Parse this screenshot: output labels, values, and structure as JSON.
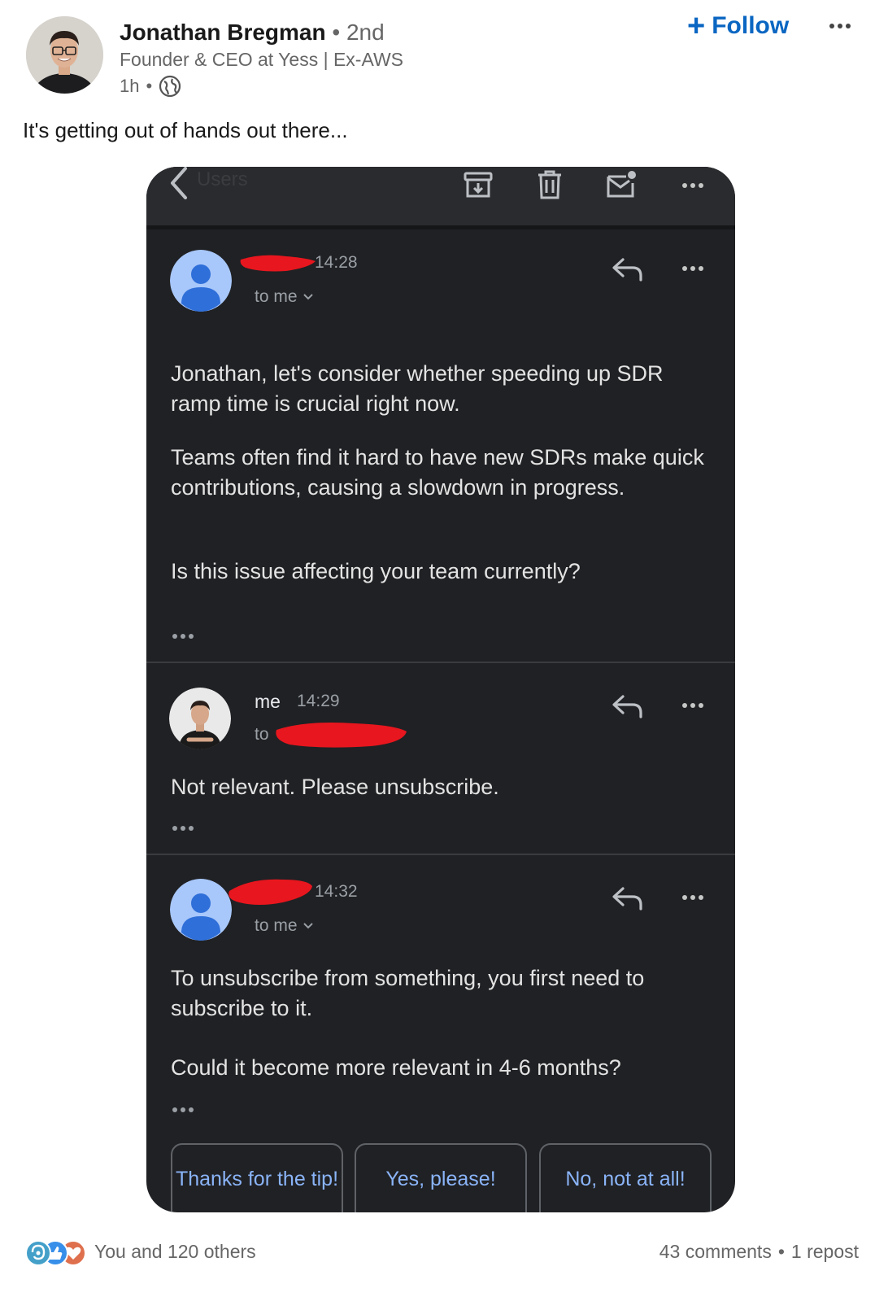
{
  "post": {
    "author_name": "Jonathan Bregman",
    "separator_dot": "•",
    "degree": "2nd",
    "headline": "Founder & CEO at Yess | Ex-AWS",
    "time_ago": "1h",
    "follow_label": "Follow",
    "follow_symbol": "+",
    "text": "It's getting out of hands out there..."
  },
  "email": {
    "back_label": "Users",
    "messages": [
      {
        "time": "14:28",
        "to_label": "to me",
        "body": [
          "Jonathan, let's consider whether speeding up SDR ramp time is crucial right now.",
          "Teams often find it hard to have new SDRs make quick contributions, causing a slowdown in progress.",
          "Is this issue affecting your team currently?"
        ]
      },
      {
        "sender": "me",
        "time": "14:29",
        "to_label": "to",
        "body": [
          "Not relevant. Please unsubscribe."
        ]
      },
      {
        "time": "14:32",
        "to_label": "to me",
        "body": [
          "To unsubscribe from something, you first need to subscribe to it.",
          "Could it become more relevant in 4-6 months?"
        ]
      }
    ],
    "smart_replies": [
      "Thanks for the tip!",
      "Yes, please!",
      "No, not at all!"
    ]
  },
  "footer": {
    "reactions_label": "You and 120 others",
    "comments": "43 comments",
    "dot": "•",
    "reposts": "1 repost"
  },
  "colors": {
    "brand_blue": "#0a66c2",
    "email_bg": "#202124",
    "gmail_link": "#8ab4f8",
    "redaction_red": "#e8161e",
    "avatar_blue": "#a8c7fa"
  }
}
